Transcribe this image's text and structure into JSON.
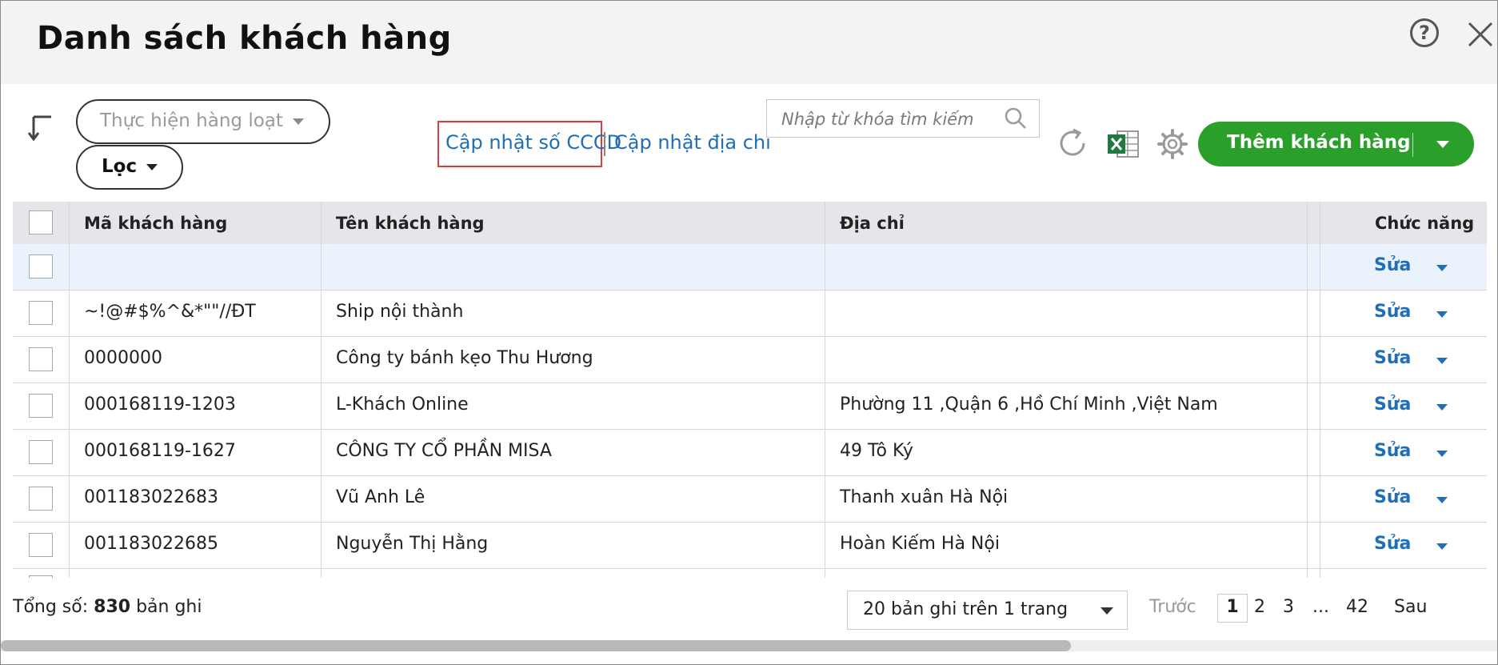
{
  "window": {
    "title": "Danh sách khách hàng"
  },
  "toolbar": {
    "bulk_action_label": "Thực hiện hàng loạt",
    "filter_label": "Lọc",
    "link_update_id": "Cập nhật số CCCD",
    "link_update_address": "Cập nhật địa chỉ",
    "search_placeholder": "Nhập từ khóa tìm kiếm",
    "add_button_label": "Thêm khách hàng",
    "accent_color": "#2aa02a",
    "link_color": "#1e6fb8",
    "highlight_color": "#e23d3d"
  },
  "table": {
    "columns": [
      "Mã khách hàng",
      "Tên khách hàng",
      "Địa chỉ",
      "Chức năng"
    ],
    "edit_label": "Sửa",
    "rows": [
      {
        "code": "",
        "name": "",
        "address": ""
      },
      {
        "code": "~!@#$%^&*\"\"//ĐT",
        "name": "Ship nội thành",
        "address": ""
      },
      {
        "code": "0000000",
        "name": "Công ty bánh kẹo Thu Hương",
        "address": ""
      },
      {
        "code": "000168119-1203",
        "name": "L-Khách Online",
        "address": "Phường 11 ,Quận 6 ,Hồ Chí Minh ,Việt Nam"
      },
      {
        "code": "000168119-1627",
        "name": "CÔNG TY CỔ PHẦN MISA",
        "address": "49 Tô Ký"
      },
      {
        "code": "001183022683",
        "name": "Vũ Anh Lê",
        "address": "Thanh xuân Hà Nội"
      },
      {
        "code": "001183022685",
        "name": "Nguyễn Thị Hằng",
        "address": "Hoàn Kiếm Hà Nội"
      }
    ]
  },
  "footer": {
    "total_prefix": "Tổng số: ",
    "total_count": "830",
    "total_suffix": " bản ghi",
    "page_size_label": "20 bản ghi trên 1 trang",
    "prev_label": "Trước",
    "pages": [
      "1",
      "2",
      "3",
      "...",
      "42"
    ],
    "next_label": "Sau"
  }
}
